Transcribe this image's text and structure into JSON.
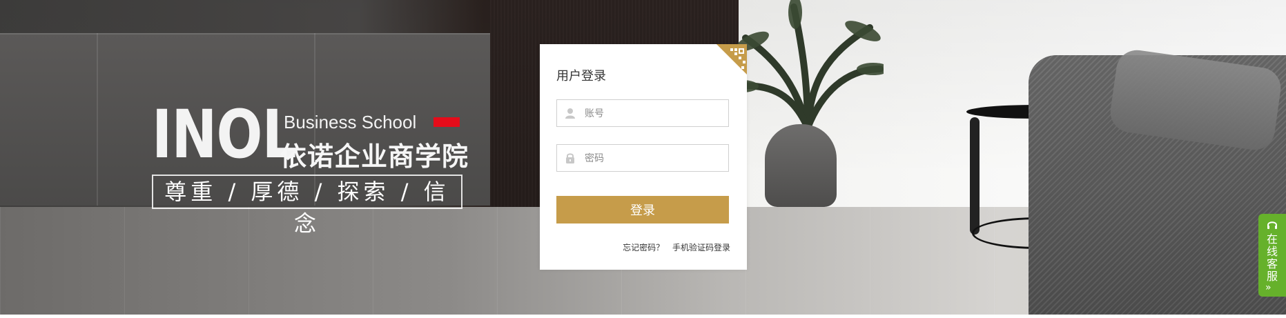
{
  "brand": {
    "logo_text": "INOL",
    "subtitle_en": "Business School",
    "subtitle_cn": "依诺企业商学院",
    "motto": "尊重 / 厚德 / 探索 / 信念",
    "accent_red": "#e50c1a"
  },
  "login": {
    "title": "用户登录",
    "account_placeholder": "账号",
    "password_placeholder": "密码",
    "submit_label": "登录",
    "forgot_label": "忘记密码？",
    "sms_login_label": "手机验证码登录",
    "accent_gold": "#c69c4a",
    "qr_icon": "qr-code-icon",
    "account_icon": "user-icon",
    "password_icon": "lock-icon"
  },
  "service": {
    "label": "在线客服",
    "arrow": "»",
    "icon": "headset-icon",
    "color": "#66b12b"
  }
}
